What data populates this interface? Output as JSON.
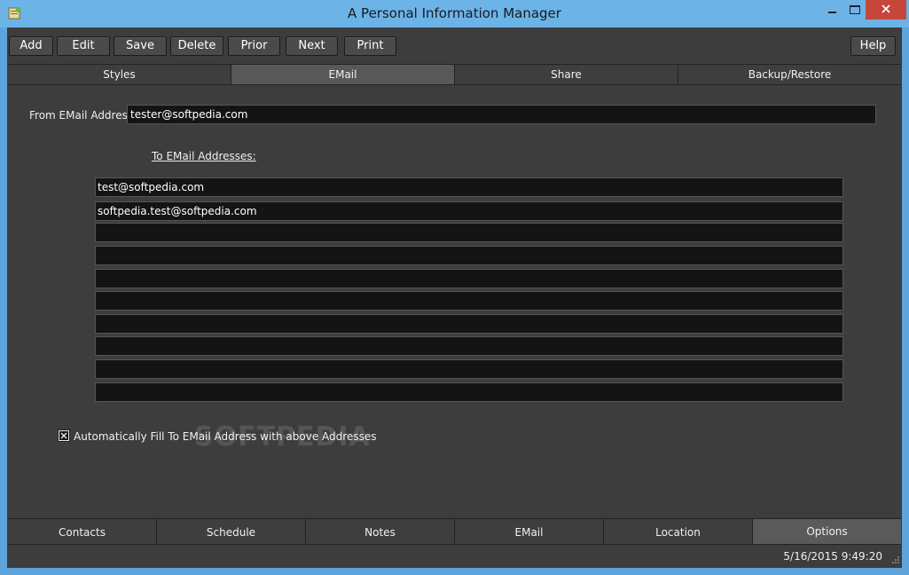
{
  "window": {
    "title": "A Personal Information Manager",
    "icon": "app-icon",
    "close_color": "#c7463a"
  },
  "toolbar": {
    "buttons": [
      "Add",
      "Edit",
      "Save",
      "Delete",
      "Prior",
      "Next",
      "Print"
    ],
    "help": "Help"
  },
  "top_tabs": {
    "items": [
      "Styles",
      "EMail",
      "Share",
      "Backup/Restore"
    ],
    "active": "EMail"
  },
  "email": {
    "from_label": "From EMail Address:",
    "from_value": "tester@softpedia.com",
    "to_label": "To EMail Addresses:",
    "to_values": [
      "test@softpedia.com",
      "softpedia.test@softpedia.com",
      "",
      "",
      "",
      "",
      "",
      "",
      "",
      ""
    ],
    "auto_fill_label": "Automatically Fill To EMail Address with above Addresses",
    "auto_fill_checked": true
  },
  "watermark": "SOFTPEDIA",
  "bottom_tabs": {
    "items": [
      "Contacts",
      "Schedule",
      "Notes",
      "EMail",
      "Location",
      "Options"
    ],
    "active": "Options"
  },
  "status": {
    "datetime": "5/16/2015 9:49:20"
  }
}
